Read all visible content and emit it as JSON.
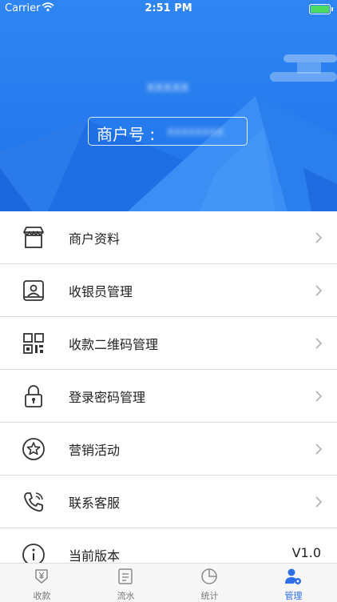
{
  "status_bar": {
    "carrier": "Carrier",
    "time": "2:51 PM"
  },
  "header": {
    "store_name": "xxxxx",
    "merchant_label": "商户号 :",
    "merchant_value": "xxxxxxxx"
  },
  "menu": [
    {
      "label": "商户资料",
      "icon": "store-icon"
    },
    {
      "label": "收银员管理",
      "icon": "cashier-id-icon"
    },
    {
      "label": "收款二维码管理",
      "icon": "qr-code-icon"
    },
    {
      "label": "登录密码管理",
      "icon": "lock-icon"
    },
    {
      "label": "营销活动",
      "icon": "star-icon"
    },
    {
      "label": "联系客服",
      "icon": "phone-icon"
    },
    {
      "label": "当前版本",
      "icon": "info-icon",
      "value": "V1.0"
    }
  ],
  "tabbar": [
    {
      "label": "收款",
      "icon": "payment-icon",
      "active": false
    },
    {
      "label": "流水",
      "icon": "ledger-icon",
      "active": false
    },
    {
      "label": "统计",
      "icon": "pie-chart-icon",
      "active": false
    },
    {
      "label": "管理",
      "icon": "user-settings-icon",
      "active": true
    }
  ],
  "colors": {
    "accent": "#2d6fe8",
    "header_blue": "#2a80f0"
  }
}
